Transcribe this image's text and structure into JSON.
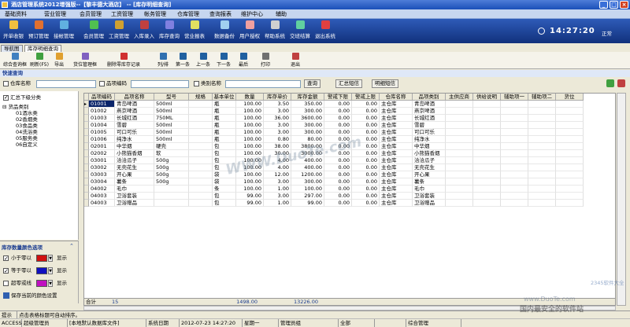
{
  "title": "酒店管理系统2012增强版--【黎丰德大酒店】 -- [库存明细查询]",
  "menu": [
    "基础资料",
    "营业管理",
    "会员管理",
    "工资管理",
    "帐务管理",
    "仓库管理",
    "查询报表",
    "维护中心",
    "辅助"
  ],
  "toolbar1": [
    "开单收银",
    "预订管理",
    "接帐管理",
    "会员管理",
    "工资管理",
    "入库录入",
    "库存查询",
    "营业报表",
    "数据备份",
    "用户授权",
    "帮助系统",
    "交班结算",
    "退出系统"
  ],
  "clock": "14:27:20",
  "status_normal": "正常",
  "tabs": [
    "导航图",
    "库存明细查询"
  ],
  "toolbar2": [
    "综合查询框",
    "刷新(F5)",
    "导出",
    "货位管理框",
    "删除零库存记录",
    "列/排",
    "第一条",
    "上一条",
    "下一条",
    "最后",
    "打印",
    "退出"
  ],
  "query": {
    "header": "快速查询",
    "warehouse_label": "仓库名称",
    "code_label": "品项编码",
    "category_label": "类别名称",
    "btn_query": "查询",
    "btn_summary": "汇总短信",
    "btn_detail": "明细短信"
  },
  "left": {
    "summary_label": "汇总下级分类",
    "root": "货品类别",
    "items": [
      "01酒水类",
      "02香烟类",
      "03食品类",
      "04洗浴类",
      "05服务类",
      "06自定义"
    ]
  },
  "colorpanel": {
    "title": "库存数量颜色选项",
    "rows": [
      {
        "label": "小于零以",
        "color": "#d01010",
        "show": "显示",
        "checked": true
      },
      {
        "label": "等于零以",
        "color": "#1010c0",
        "show": "显示",
        "checked": true
      },
      {
        "label": "超零或线",
        "color": "#c010c0",
        "show": "显示",
        "checked": false
      }
    ],
    "save": "保存当前的颜色设置"
  },
  "grid": {
    "columns": [
      "品项编码",
      "品项名称",
      "型号",
      "规格",
      "基本单位",
      "数量",
      "库存单价",
      "库存金额",
      "警戒下限",
      "警戒上限",
      "仓库名称",
      "品项类别",
      "主供应商",
      "供给说明",
      "辅助项一",
      "辅助项二",
      "货位"
    ],
    "rows": [
      [
        "01001",
        "青岛啤酒",
        "500ml",
        "",
        "瓶",
        "100.00",
        "3.50",
        "350.00",
        "0.00",
        "0.00",
        "主仓库",
        "青岛啤酒"
      ],
      [
        "01002",
        "燕京啤酒",
        "500ml",
        "",
        "瓶",
        "100.00",
        "3.00",
        "300.00",
        "0.00",
        "0.00",
        "主仓库",
        "燕京啤酒"
      ],
      [
        "01003",
        "长城红酒",
        "750ML",
        "",
        "瓶",
        "100.00",
        "36.00",
        "3600.00",
        "0.00",
        "0.00",
        "主仓库",
        "长城红酒"
      ],
      [
        "01004",
        "雪碧",
        "500ml",
        "",
        "瓶",
        "100.00",
        "3.00",
        "300.00",
        "0.00",
        "0.00",
        "主仓库",
        "雪碧"
      ],
      [
        "01005",
        "可口可乐",
        "500ml",
        "",
        "瓶",
        "100.00",
        "3.00",
        "300.00",
        "0.00",
        "0.00",
        "主仓库",
        "可口可乐"
      ],
      [
        "01006",
        "纯净水",
        "500ml",
        "",
        "瓶",
        "100.00",
        "0.80",
        "80.00",
        "0.00",
        "0.00",
        "主仓库",
        "纯净水"
      ],
      [
        "02001",
        "中华烟",
        "硬壳",
        "",
        "包",
        "100.00",
        "38.00",
        "3800.00",
        "0.00",
        "0.00",
        "主仓库",
        "中华烟"
      ],
      [
        "02002",
        "小熊猫香烟",
        "软",
        "",
        "包",
        "100.00",
        "30.00",
        "3000.00",
        "0.00",
        "0.00",
        "主仓库",
        "小熊猫香烟"
      ],
      [
        "03001",
        "洽洽瓜子",
        "500g",
        "",
        "包",
        "100.00",
        "4.00",
        "400.00",
        "0.00",
        "0.00",
        "主仓库",
        "洽洽瓜子"
      ],
      [
        "03002",
        "无壳花生",
        "500g",
        "",
        "包",
        "100.00",
        "4.00",
        "400.00",
        "0.00",
        "0.00",
        "主仓库",
        "无壳花生"
      ],
      [
        "03003",
        "开心果",
        "500g",
        "",
        "袋",
        "100.00",
        "12.00",
        "1200.00",
        "0.00",
        "0.00",
        "主仓库",
        "开心果"
      ],
      [
        "03004",
        "薯条",
        "500g",
        "",
        "袋",
        "100.00",
        "3.00",
        "300.00",
        "0.00",
        "0.00",
        "主仓库",
        "薯条"
      ],
      [
        "04002",
        "毛巾",
        "",
        "",
        "条",
        "100.00",
        "1.00",
        "100.00",
        "0.00",
        "0.00",
        "主仓库",
        "毛巾"
      ],
      [
        "04003",
        "卫浴套装",
        "",
        "",
        "包",
        "99.00",
        "3.00",
        "297.00",
        "0.00",
        "0.00",
        "主仓库",
        "卫浴套装"
      ],
      [
        "04003",
        "卫浴赠品",
        "",
        "",
        "包",
        "99.00",
        "1.00",
        "99.00",
        "0.00",
        "0.00",
        "主仓库",
        "卫浴赠品"
      ]
    ],
    "total_label": "合计",
    "total_count": "15",
    "total_qty": "1498.00",
    "total_amount": "13226.00"
  },
  "status": {
    "tip_label": "提示",
    "tip_text": "点击表格标题可自动排序。",
    "cells": [
      "ACCESS",
      "超级管理员",
      "[本地默认数据库文件]",
      "系统日期",
      "2012-07-23 14:27:20",
      "星期一",
      "管理员组",
      "全部",
      "",
      "综合管理"
    ]
  },
  "watermark": "WWW.DuoTe.com",
  "corner_wm1": "www.DuoTe.com",
  "corner_wm2": "国内最安全的软件站",
  "corner_wm3": "2345软件大全"
}
